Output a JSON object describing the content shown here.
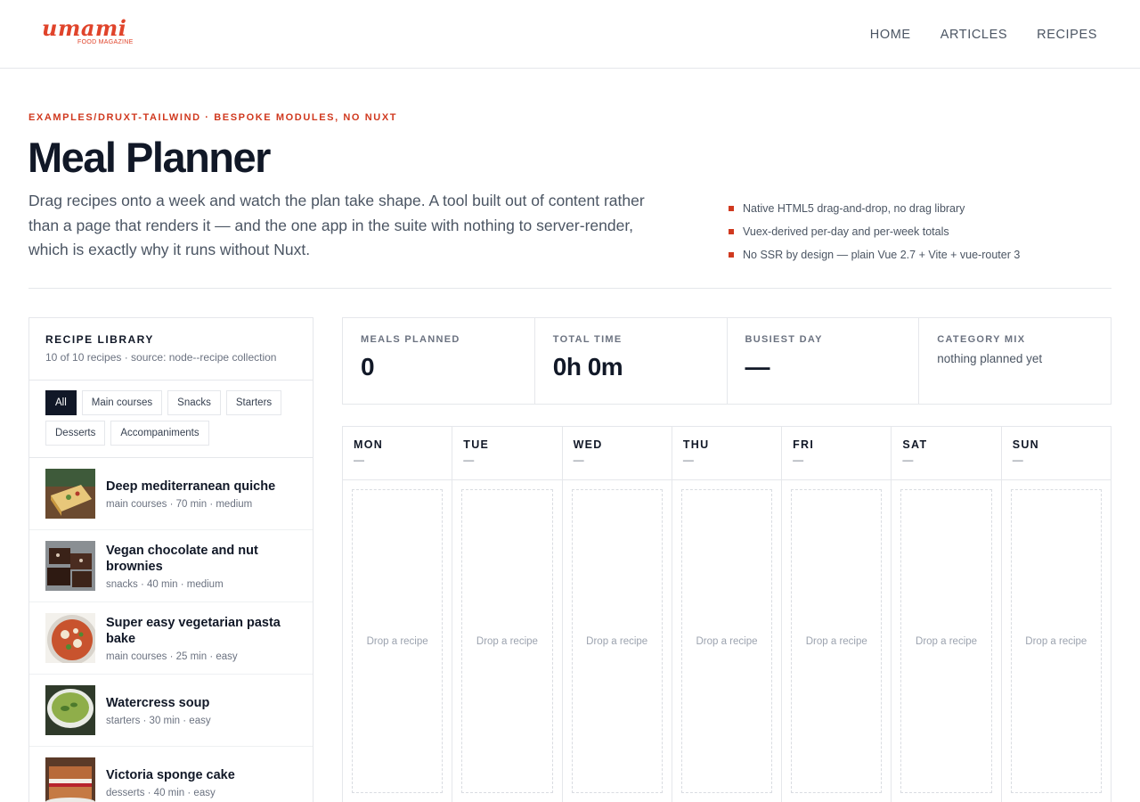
{
  "header": {
    "logo_word": "umami",
    "logo_sub": "FOOD MAGAZINE",
    "nav": [
      "HOME",
      "ARTICLES",
      "RECIPES"
    ]
  },
  "intro": {
    "eyebrow": "EXAMPLES/DRUXT-TAILWIND · BESPOKE MODULES, NO NUXT",
    "title": "Meal Planner",
    "lede": "Drag recipes onto a week and watch the plan take shape. A tool built out of content rather than a page that renders it — and the one app in the suite with nothing to server-render, which is exactly why it runs without Nuxt.",
    "features": [
      "Native HTML5 drag-and-drop, no drag library",
      "Vuex-derived per-day and per-week totals",
      "No SSR by design — plain Vue 2.7 + Vite + vue-router 3"
    ]
  },
  "library": {
    "title": "RECIPE LIBRARY",
    "subtitle": "10 of 10 recipes · source: node--recipe collection",
    "filters": [
      "All",
      "Main courses",
      "Snacks",
      "Starters",
      "Desserts",
      "Accompaniments"
    ],
    "active_filter": "All",
    "recipes": [
      {
        "name": "Deep mediterranean quiche",
        "meta": "main courses · 70 min · medium",
        "image": "quiche"
      },
      {
        "name": "Vegan chocolate and nut brownies",
        "meta": "snacks · 40 min · medium",
        "image": "brownies"
      },
      {
        "name": "Super easy vegetarian pasta bake",
        "meta": "main courses · 25 min · easy",
        "image": "pasta-bake"
      },
      {
        "name": "Watercress soup",
        "meta": "starters · 30 min · easy",
        "image": "soup"
      },
      {
        "name": "Victoria sponge cake",
        "meta": "desserts · 40 min · easy",
        "image": "cake"
      }
    ]
  },
  "stats": {
    "meals_label": "MEALS PLANNED",
    "meals_value": "0",
    "time_label": "TOTAL TIME",
    "time_value": "0h 0m",
    "busiest_label": "BUSIEST DAY",
    "busiest_value": "—",
    "mix_label": "CATEGORY MIX",
    "mix_value": "nothing planned yet"
  },
  "week": {
    "days": [
      {
        "name": "MON",
        "total": "—",
        "drop": "Drop a recipe"
      },
      {
        "name": "TUE",
        "total": "—",
        "drop": "Drop a recipe"
      },
      {
        "name": "WED",
        "total": "—",
        "drop": "Drop a recipe"
      },
      {
        "name": "THU",
        "total": "—",
        "drop": "Drop a recipe"
      },
      {
        "name": "FRI",
        "total": "—",
        "drop": "Drop a recipe"
      },
      {
        "name": "SAT",
        "total": "—",
        "drop": "Drop a recipe"
      },
      {
        "name": "SUN",
        "total": "—",
        "drop": "Drop a recipe"
      }
    ]
  },
  "colors": {
    "accent": "#d0391f",
    "logo": "#e0442b",
    "ink": "#111827",
    "muted": "#6b7280",
    "border": "#e5e7eb"
  }
}
